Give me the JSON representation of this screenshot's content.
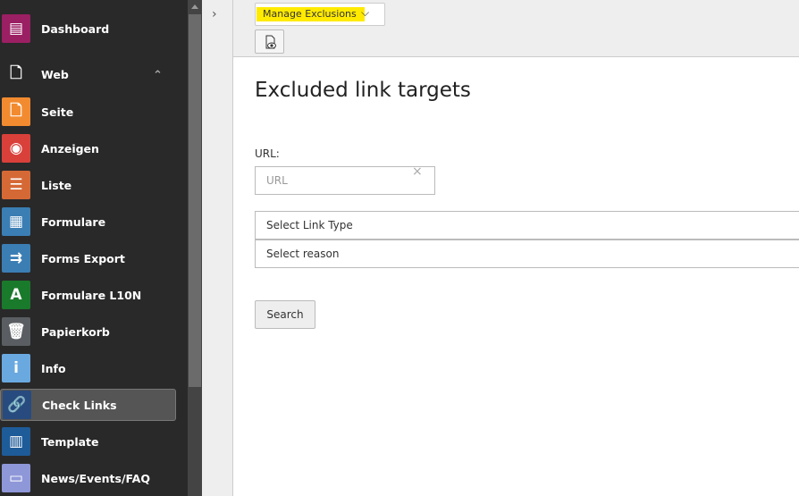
{
  "sidebar": {
    "items": [
      {
        "label": "Dashboard",
        "icon": "dashboard-icon",
        "color": "#9b1f63"
      },
      {
        "label": "Web",
        "icon": "page-icon",
        "color": ""
      },
      {
        "label": "Seite",
        "icon": "page-icon",
        "color": "#f28b30"
      },
      {
        "label": "Anzeigen",
        "icon": "eye-icon",
        "color": "#d9403a"
      },
      {
        "label": "Liste",
        "icon": "list-icon",
        "color": "#d56936"
      },
      {
        "label": "Formulare",
        "icon": "form-icon",
        "color": "#3b7eb4"
      },
      {
        "label": "Forms Export",
        "icon": "form-export-icon",
        "color": "#3b7eb4"
      },
      {
        "label": "Formulare L10N",
        "icon": "form-l10n-icon",
        "color": "#1a7a2b"
      },
      {
        "label": "Papierkorb",
        "icon": "trash-icon",
        "color": "#5a5e62"
      },
      {
        "label": "Info",
        "icon": "info-icon",
        "color": "#6aa9e0"
      },
      {
        "label": "Check Links",
        "icon": "link-icon",
        "color": "#274b7e"
      },
      {
        "label": "Template",
        "icon": "template-icon",
        "color": "#1e5b99"
      },
      {
        "label": "News/Events/FAQ",
        "icon": "news-icon",
        "color": "#8e97d8"
      }
    ]
  },
  "toolbar": {
    "menu_selected": "Manage Exclusions"
  },
  "main": {
    "title": "Excluded link targets",
    "url_label": "URL:",
    "url_placeholder": "URL",
    "url_value": "",
    "link_type": "Select Link Type",
    "reason": "Select reason",
    "search_label": "Search"
  }
}
